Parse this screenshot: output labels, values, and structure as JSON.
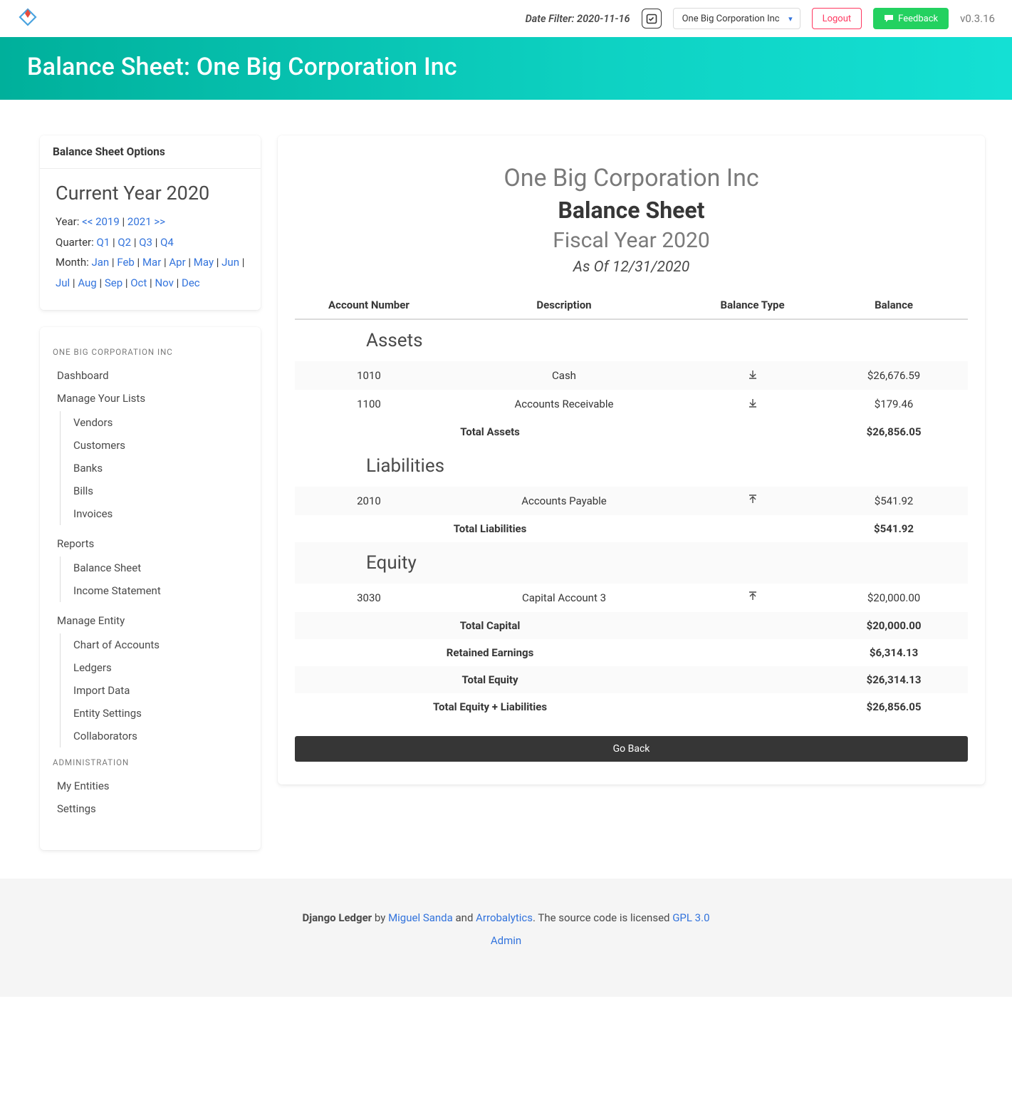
{
  "navbar": {
    "date_filter_label": "Date Filter: 2020-11-16",
    "entity_selected": "One Big Corporation Inc",
    "logout": "Logout",
    "feedback": "Feedback",
    "version": "v0.3.16"
  },
  "hero": {
    "title": "Balance Sheet: One Big Corporation Inc"
  },
  "options": {
    "header": "Balance Sheet Options",
    "current_year_title": "Current Year 2020",
    "year_label": "Year: ",
    "prev_year": "<< 2019",
    "next_year": "2021 >>",
    "quarter_label": "Quarter: ",
    "quarters": [
      "Q1",
      "Q2",
      "Q3",
      "Q4"
    ],
    "month_label": "Month: ",
    "months": [
      "Jan",
      "Feb",
      "Mar",
      "Apr",
      "May",
      "Jun",
      "Jul",
      "Aug",
      "Sep",
      "Oct",
      "Nov",
      "Dec"
    ]
  },
  "menu": {
    "entity_label": "ONE BIG CORPORATION INC",
    "dashboard": "Dashboard",
    "manage_lists": "Manage Your Lists",
    "lists": [
      "Vendors",
      "Customers",
      "Banks",
      "Bills",
      "Invoices"
    ],
    "reports": "Reports",
    "reports_items": [
      "Balance Sheet",
      "Income Statement"
    ],
    "manage_entity": "Manage Entity",
    "entity_items": [
      "Chart of Accounts",
      "Ledgers",
      "Import Data",
      "Entity Settings",
      "Collaborators"
    ],
    "admin_label": "ADMINISTRATION",
    "admin_items": [
      "My Entities",
      "Settings"
    ]
  },
  "report": {
    "company": "One Big Corporation Inc",
    "title": "Balance Sheet",
    "period": "Fiscal Year 2020",
    "as_of": "As Of 12/31/2020",
    "columns": {
      "acct": "Account Number",
      "desc": "Description",
      "type": "Balance Type",
      "bal": "Balance"
    },
    "sections": {
      "assets": "Assets",
      "liabilities": "Liabilities",
      "equity": "Equity"
    },
    "rows": {
      "a1": {
        "acct": "1010",
        "desc": "Cash",
        "type": "debit",
        "bal": "$26,676.59"
      },
      "a2": {
        "acct": "1100",
        "desc": "Accounts Receivable",
        "type": "debit",
        "bal": "$179.46"
      },
      "total_assets": {
        "label": "Total Assets",
        "bal": "$26,856.05"
      },
      "l1": {
        "acct": "2010",
        "desc": "Accounts Payable",
        "type": "credit",
        "bal": "$541.92"
      },
      "total_liab": {
        "label": "Total Liabilities",
        "bal": "$541.92"
      },
      "e1": {
        "acct": "3030",
        "desc": "Capital Account 3",
        "type": "credit",
        "bal": "$20,000.00"
      },
      "total_capital": {
        "label": "Total Capital",
        "bal": "$20,000.00"
      },
      "retained": {
        "label": "Retained Earnings",
        "bal": "$6,314.13"
      },
      "total_equity": {
        "label": "Total Equity",
        "bal": "$26,314.13"
      },
      "total_el": {
        "label": "Total Equity + Liabilities",
        "bal": "$26,856.05"
      }
    },
    "goback": "Go Back"
  },
  "footer": {
    "prefix": "Django Ledger",
    "by": " by ",
    "author": "Miguel Sanda",
    "and": " and ",
    "company": "Arrobalytics",
    "license_text": ". The source code is licensed ",
    "license": "GPL 3.0",
    "admin": "Admin"
  }
}
